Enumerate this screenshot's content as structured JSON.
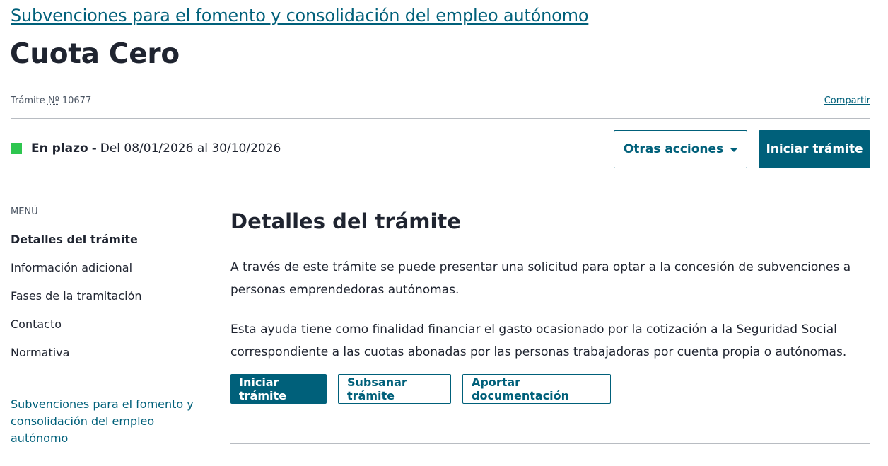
{
  "header": {
    "parent_link": "Subvenciones para el fomento y consolidación del empleo autónomo",
    "title": "Cuota Cero",
    "tramite_prefix": "Trámite",
    "tramite_no": "Nº",
    "tramite_number": "10677",
    "share_label": "Compartir"
  },
  "status": {
    "label": "En plazo",
    "separator": "-",
    "dates": "Del 08/01/2026 al 30/10/2026",
    "color": "#2ec64f"
  },
  "actions": {
    "other_actions_label": "Otras acciones",
    "start_label": "Iniciar trámite"
  },
  "sidebar": {
    "heading": "MENÚ",
    "items": [
      {
        "label": "Detalles del trámite"
      },
      {
        "label": "Información adicional"
      },
      {
        "label": "Fases de la tramitación"
      },
      {
        "label": "Contacto"
      },
      {
        "label": "Normativa"
      }
    ],
    "parent_link": "Subvenciones para el fomento y consolidación del empleo autónomo"
  },
  "main": {
    "title": "Detalles del trámite",
    "paragraphs": [
      "A través de este trámite se puede presentar una solicitud para optar a la concesión de subvenciones a personas emprendedoras autónomas.",
      "Esta ayuda tiene como finalidad financiar el gasto ocasionado por la cotización a la Seguridad Social correspondiente a las cuotas abonadas por las personas trabajadoras por cuenta propia o autónomas."
    ],
    "buttons": {
      "start": "Iniciar trámite",
      "fix": "Subsanar trámite",
      "docs": "Aportar documentación"
    }
  },
  "colors": {
    "accent": "#00607a",
    "text": "#1f2430",
    "status_green": "#2ec64f"
  }
}
